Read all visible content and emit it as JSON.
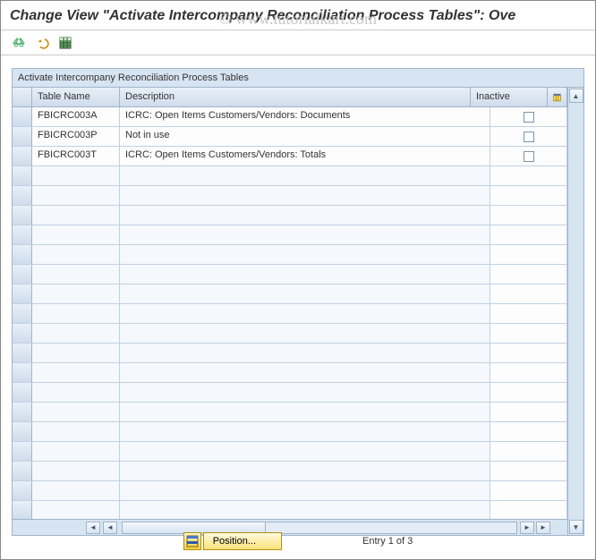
{
  "window": {
    "title": "Change View \"Activate Intercompany Reconciliation Process Tables\": Ove"
  },
  "watermark": "© www.tutorialkart.com",
  "panel": {
    "title": "Activate Intercompany Reconciliation Process Tables"
  },
  "columns": {
    "table_name": "Table Name",
    "description": "Description",
    "inactive": "Inactive"
  },
  "rows": [
    {
      "table_name": "FBICRC003A",
      "description": "ICRC: Open Items Customers/Vendors: Documents",
      "inactive": false
    },
    {
      "table_name": "FBICRC003P",
      "description": "Not in use",
      "inactive": false
    },
    {
      "table_name": "FBICRC003T",
      "description": "ICRC: Open Items Customers/Vendors: Totals",
      "inactive": false
    }
  ],
  "footer": {
    "position_label": "Position...",
    "entry_info": "Entry 1 of 3"
  }
}
